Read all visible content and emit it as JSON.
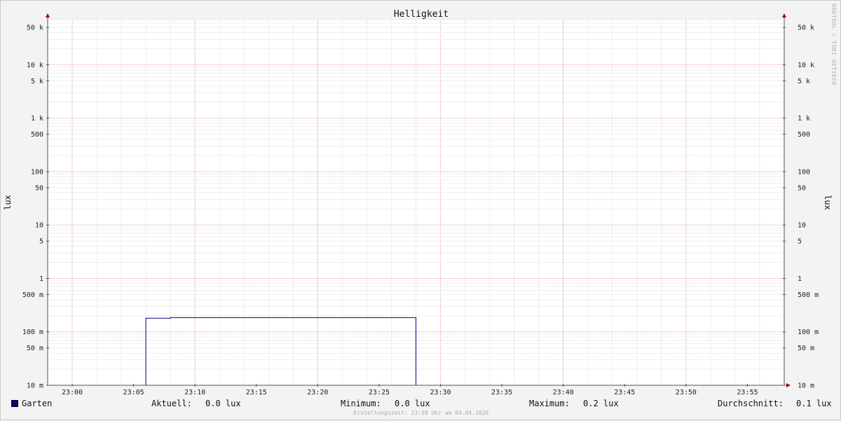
{
  "chart_data": {
    "type": "line",
    "title": "Helligkeit",
    "ylabel": "lux",
    "yscale": "log",
    "ylim": [
      0.01,
      70000
    ],
    "xlim": [
      "22:58",
      "23:58"
    ],
    "x_ticks": [
      "23:00",
      "23:05",
      "23:10",
      "23:15",
      "23:20",
      "23:25",
      "23:30",
      "23:35",
      "23:40",
      "23:45",
      "23:50",
      "23:55"
    ],
    "y_ticks": [
      {
        "value": 0.01,
        "label": "10 m"
      },
      {
        "value": 0.05,
        "label": "50 m"
      },
      {
        "value": 0.1,
        "label": "100 m"
      },
      {
        "value": 0.5,
        "label": "500 m"
      },
      {
        "value": 1,
        "label": "1"
      },
      {
        "value": 5,
        "label": "5"
      },
      {
        "value": 10,
        "label": "10"
      },
      {
        "value": 50,
        "label": "50"
      },
      {
        "value": 100,
        "label": "100"
      },
      {
        "value": 500,
        "label": "500"
      },
      {
        "value": 1000,
        "label": "1 k"
      },
      {
        "value": 5000,
        "label": "5 k"
      },
      {
        "value": 10000,
        "label": "10 k"
      },
      {
        "value": 50000,
        "label": "50 k"
      }
    ],
    "grid": true,
    "series": [
      {
        "name": "Garten",
        "color": "#000080",
        "step": true,
        "points": [
          {
            "x": "22:58",
            "y": 0.01
          },
          {
            "x": "23:06",
            "y": 0.01
          },
          {
            "x": "23:06",
            "y": 0.18
          },
          {
            "x": "23:08",
            "y": 0.18
          },
          {
            "x": "23:08",
            "y": 0.185
          },
          {
            "x": "23:28",
            "y": 0.185
          },
          {
            "x": "23:28",
            "y": 0.01
          },
          {
            "x": "23:58",
            "y": 0.01
          }
        ]
      }
    ]
  },
  "legend": {
    "series_name": "Garten",
    "current_label": "Aktuell:",
    "current_value": "0.0 lux",
    "min_label": "Minimum:",
    "min_value": "0.0 lux",
    "max_label": "Maximum:",
    "max_value": "0.2 lux",
    "avg_label": "Durchschnitt:",
    "avg_value": "0.1 lux"
  },
  "footer": "Erstellungszeit: 23:58 Uhr am 04.04.2026",
  "watermark": "RRDTOOL / TOBI OETIKER"
}
